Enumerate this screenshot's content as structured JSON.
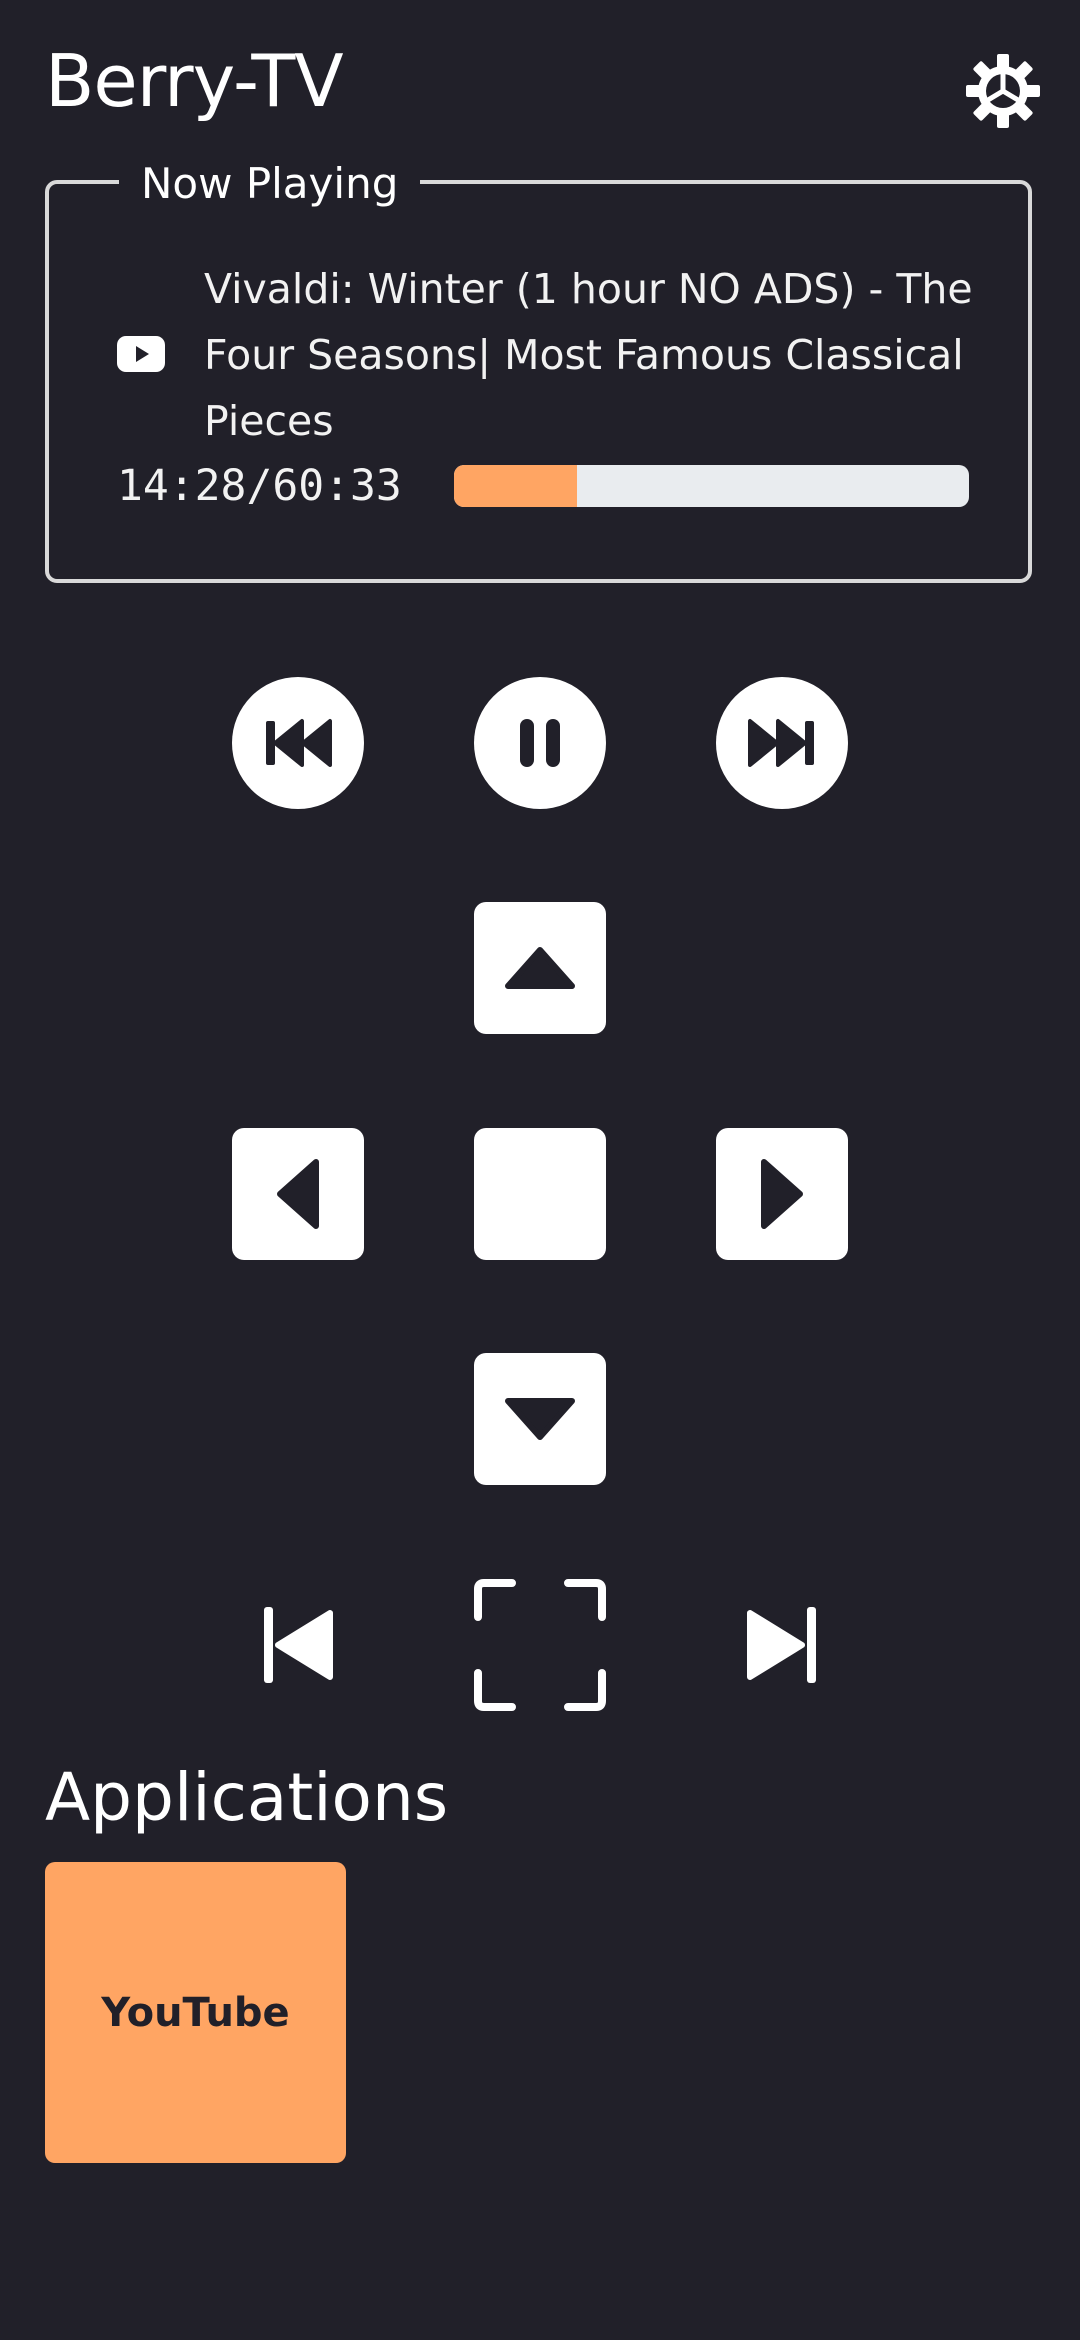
{
  "app": {
    "title": "Berry-TV"
  },
  "now_playing": {
    "legend": "Now Playing",
    "source_icon": "youtube-icon",
    "title": "Vivaldi: Winter (1 hour NO ADS) - The Four Seasons| Most Famous Classical Pieces",
    "time": "14:28/60:33",
    "progress_fraction": 0.239
  },
  "controls": {
    "media": [
      "rewind-icon",
      "pause-icon",
      "fast-forward-icon"
    ],
    "dpad": [
      "arrow-up-icon",
      "arrow-left-icon",
      "ok-icon",
      "arrow-right-icon",
      "arrow-down-icon"
    ],
    "bottom": [
      "skip-previous-icon",
      "fullscreen-icon",
      "skip-next-icon"
    ]
  },
  "applications": {
    "heading": "Applications",
    "items": [
      {
        "label": "YouTube"
      }
    ]
  },
  "colors": {
    "background": "#212029",
    "accent": "#ffa563",
    "progress_track": "#e9ecef",
    "button": "#ffffff"
  }
}
